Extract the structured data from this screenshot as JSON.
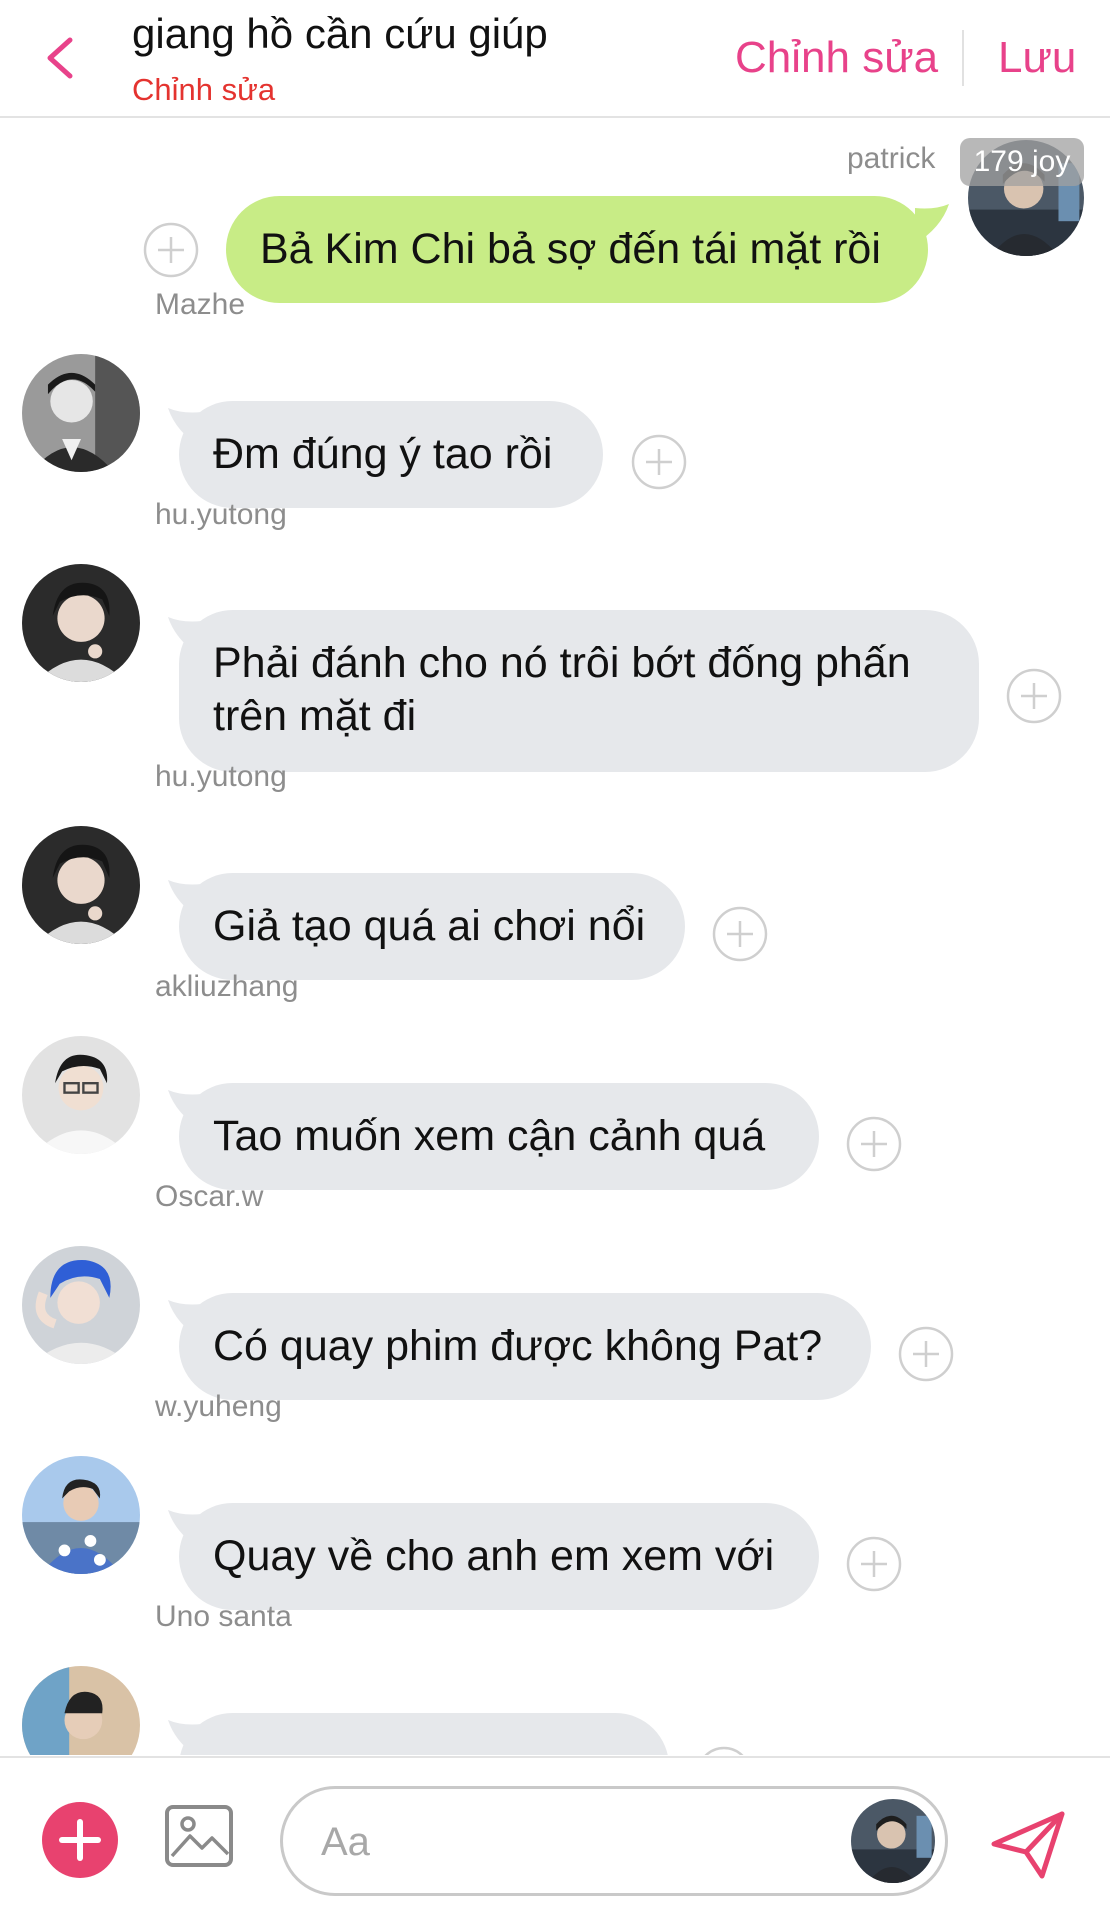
{
  "header": {
    "title": "giang hồ cần cứu giúp",
    "subtitle": "Chỉnh sửa",
    "edit_label": "Chỉnh sửa",
    "save_label": "Lưu"
  },
  "colors": {
    "accent": "#e8428a",
    "outgoing_bubble": "#c8ec86",
    "incoming_bubble": "#e6e8eb",
    "subtitle": "#e4332f"
  },
  "messages": [
    {
      "sender": "patrick",
      "nickname": "179 joy",
      "text": "Bả Kim Chi bả sợ đến tái mặt rồi",
      "outgoing": true
    },
    {
      "sender": "Mazhe",
      "text": "Đm đúng ý tao rồi"
    },
    {
      "sender": "hu.yutong",
      "text": "Phải đánh cho nó trôi bớt đống phấn trên mặt đi"
    },
    {
      "sender": "hu.yutong",
      "text": "Giả tạo quá ai chơi nổi"
    },
    {
      "sender": "akliuzhang",
      "text": "Tao muốn xem cận cảnh quá"
    },
    {
      "sender": "Oscar.w",
      "text": "Có quay phim được không Pat?"
    },
    {
      "sender": "w.yuheng",
      "text": "Quay về cho anh em xem với"
    },
    {
      "sender": "Uno santa",
      "text": ""
    }
  ],
  "composer": {
    "placeholder": "Aa"
  },
  "icons": [
    "back-icon",
    "plus-circle-icon",
    "add-icon",
    "image-icon",
    "send-icon"
  ]
}
